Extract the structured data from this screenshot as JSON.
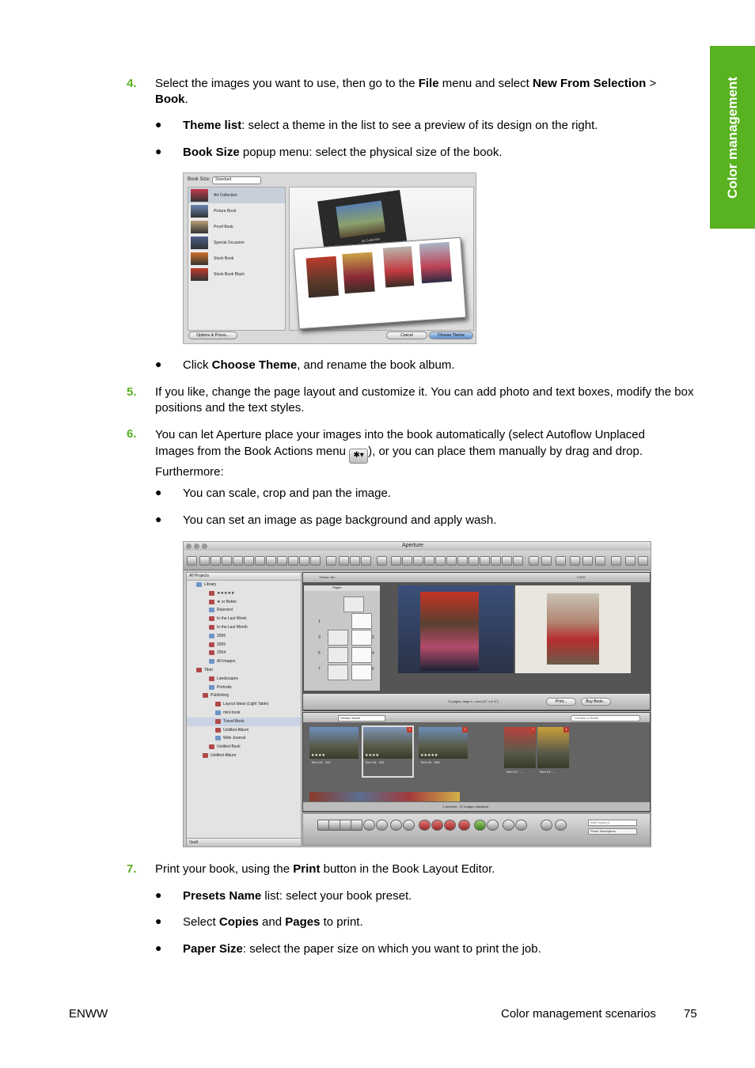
{
  "side_tab": "Color management",
  "step4": {
    "num": "4.",
    "t1": "Select the images you want to use, then go to the ",
    "b1": "File",
    "t2": " menu and select ",
    "b2": "New From Selection",
    "t3": " > ",
    "b3": "Book",
    "t4": ".",
    "bullets": [
      {
        "bold": "Theme list",
        "text": ": select a theme in the list to see a preview of its design on the right."
      },
      {
        "bold": "Book Size",
        "text": " popup menu: select the physical size of the book."
      }
    ]
  },
  "shot1": {
    "book_size_label": "Book Size:",
    "book_size_value": "Standard",
    "themes": [
      "Art Collection",
      "Picture Book",
      "Proof Book",
      "Special Occasion",
      "Stock Book",
      "Stock Book Black"
    ],
    "book_cover_text": "Art Collection",
    "options_button": "Options & Prices...",
    "cancel_button": "Cancel",
    "choose_button": "Choose Theme"
  },
  "after_shot1": {
    "t1": "Click ",
    "b1": "Choose Theme",
    "t2": ", and rename the book album."
  },
  "step5": {
    "num": "5.",
    "text": "If you like, change the page layout and customize it. You can add photo and text boxes, modify the box positions and the text styles."
  },
  "step6": {
    "num": "6.",
    "line1": "You can let Aperture place your images into the book automatically (select Autoflow Unplaced",
    "line2a": "Images from the Book Actions menu ",
    "line2b": "), or you can place them manually by drag and drop.",
    "line3": "Furthermore:",
    "bullets": [
      "You can scale, crop and pan the image.",
      "You can set an image as page background and apply wash."
    ]
  },
  "shot2": {
    "title": "Aperture",
    "projects_header": "All Projects",
    "tree": [
      {
        "label": "Library",
        "indent": 0
      },
      {
        "label": "★★★★★",
        "indent": 2
      },
      {
        "label": "★ or Better",
        "indent": 2
      },
      {
        "label": "Rejected",
        "indent": 2
      },
      {
        "label": "In the Last Week",
        "indent": 2
      },
      {
        "label": "In the Last Month",
        "indent": 2
      },
      {
        "label": "2006",
        "indent": 2
      },
      {
        "label": "2005",
        "indent": 2
      },
      {
        "label": "2004",
        "indent": 2
      },
      {
        "label": "All Images",
        "indent": 2
      },
      {
        "label": "Tibet",
        "indent": 0
      },
      {
        "label": "Landscapes",
        "indent": 2
      },
      {
        "label": "Portraits",
        "indent": 2
      },
      {
        "label": "Publishing",
        "indent": 1
      },
      {
        "label": "Layout Ideas (Light Table)",
        "indent": 3
      },
      {
        "label": "mini book",
        "indent": 3
      },
      {
        "label": "Travel Book",
        "indent": 3
      },
      {
        "label": "Untitled Album",
        "indent": 3
      },
      {
        "label": "Web Journal",
        "indent": 3
      },
      {
        "label": "Untitled Book",
        "indent": 2
      },
      {
        "label": "Untitled Album",
        "indent": 1
      }
    ],
    "vault_label": "Vault",
    "theme_label": "Theme: Art...",
    "pages_header": "Pages",
    "page_nums": [
      "1",
      "2",
      "3",
      "4",
      "5",
      "6",
      "7"
    ],
    "lock_label": "LOCK",
    "pages_status": "19 pages, large h...over (11\" x 8 ½\")",
    "print_button": "Print...",
    "buy_button": "Buy Book...",
    "sort_label": "Version Name",
    "filter_label": "Unrated or Better",
    "filmstrip": [
      {
        "caption": "Tibet 05 - 090",
        "stars": "★★★★",
        "badge": ""
      },
      {
        "caption": "Tibet 05 - 083",
        "stars": "★★★★",
        "badge": "1"
      },
      {
        "caption": "Tibet 05 - 608",
        "stars": "★★★★★",
        "badge": "2"
      },
      {
        "caption": "Tibet 03 - ...",
        "stars": "",
        "badge": "1"
      },
      {
        "caption": "Tibet 03 - ...",
        "stars": "",
        "badge": "1"
      }
    ],
    "browser_status": "1 selected - 37 images displayed",
    "keyword_placeholder": "Add Keyword",
    "keyword_set": "Photo Descriptors"
  },
  "step7": {
    "num": "7.",
    "t1": "Print your book, using the ",
    "b1": "Print",
    "t2": " button in the Book Layout Editor.",
    "bullets": [
      {
        "pre": "",
        "bold": "Presets Name",
        "text": " list: select your book preset."
      },
      {
        "pre": "Select ",
        "bold": "Copies",
        "mid": " and ",
        "bold2": "Pages",
        "text": " to print."
      },
      {
        "pre": "",
        "bold": "Paper Size",
        "text": ": select the paper size on which you want to print the job."
      }
    ]
  },
  "footer": {
    "left": "ENWW",
    "right": "Color management scenarios",
    "page": "75"
  }
}
